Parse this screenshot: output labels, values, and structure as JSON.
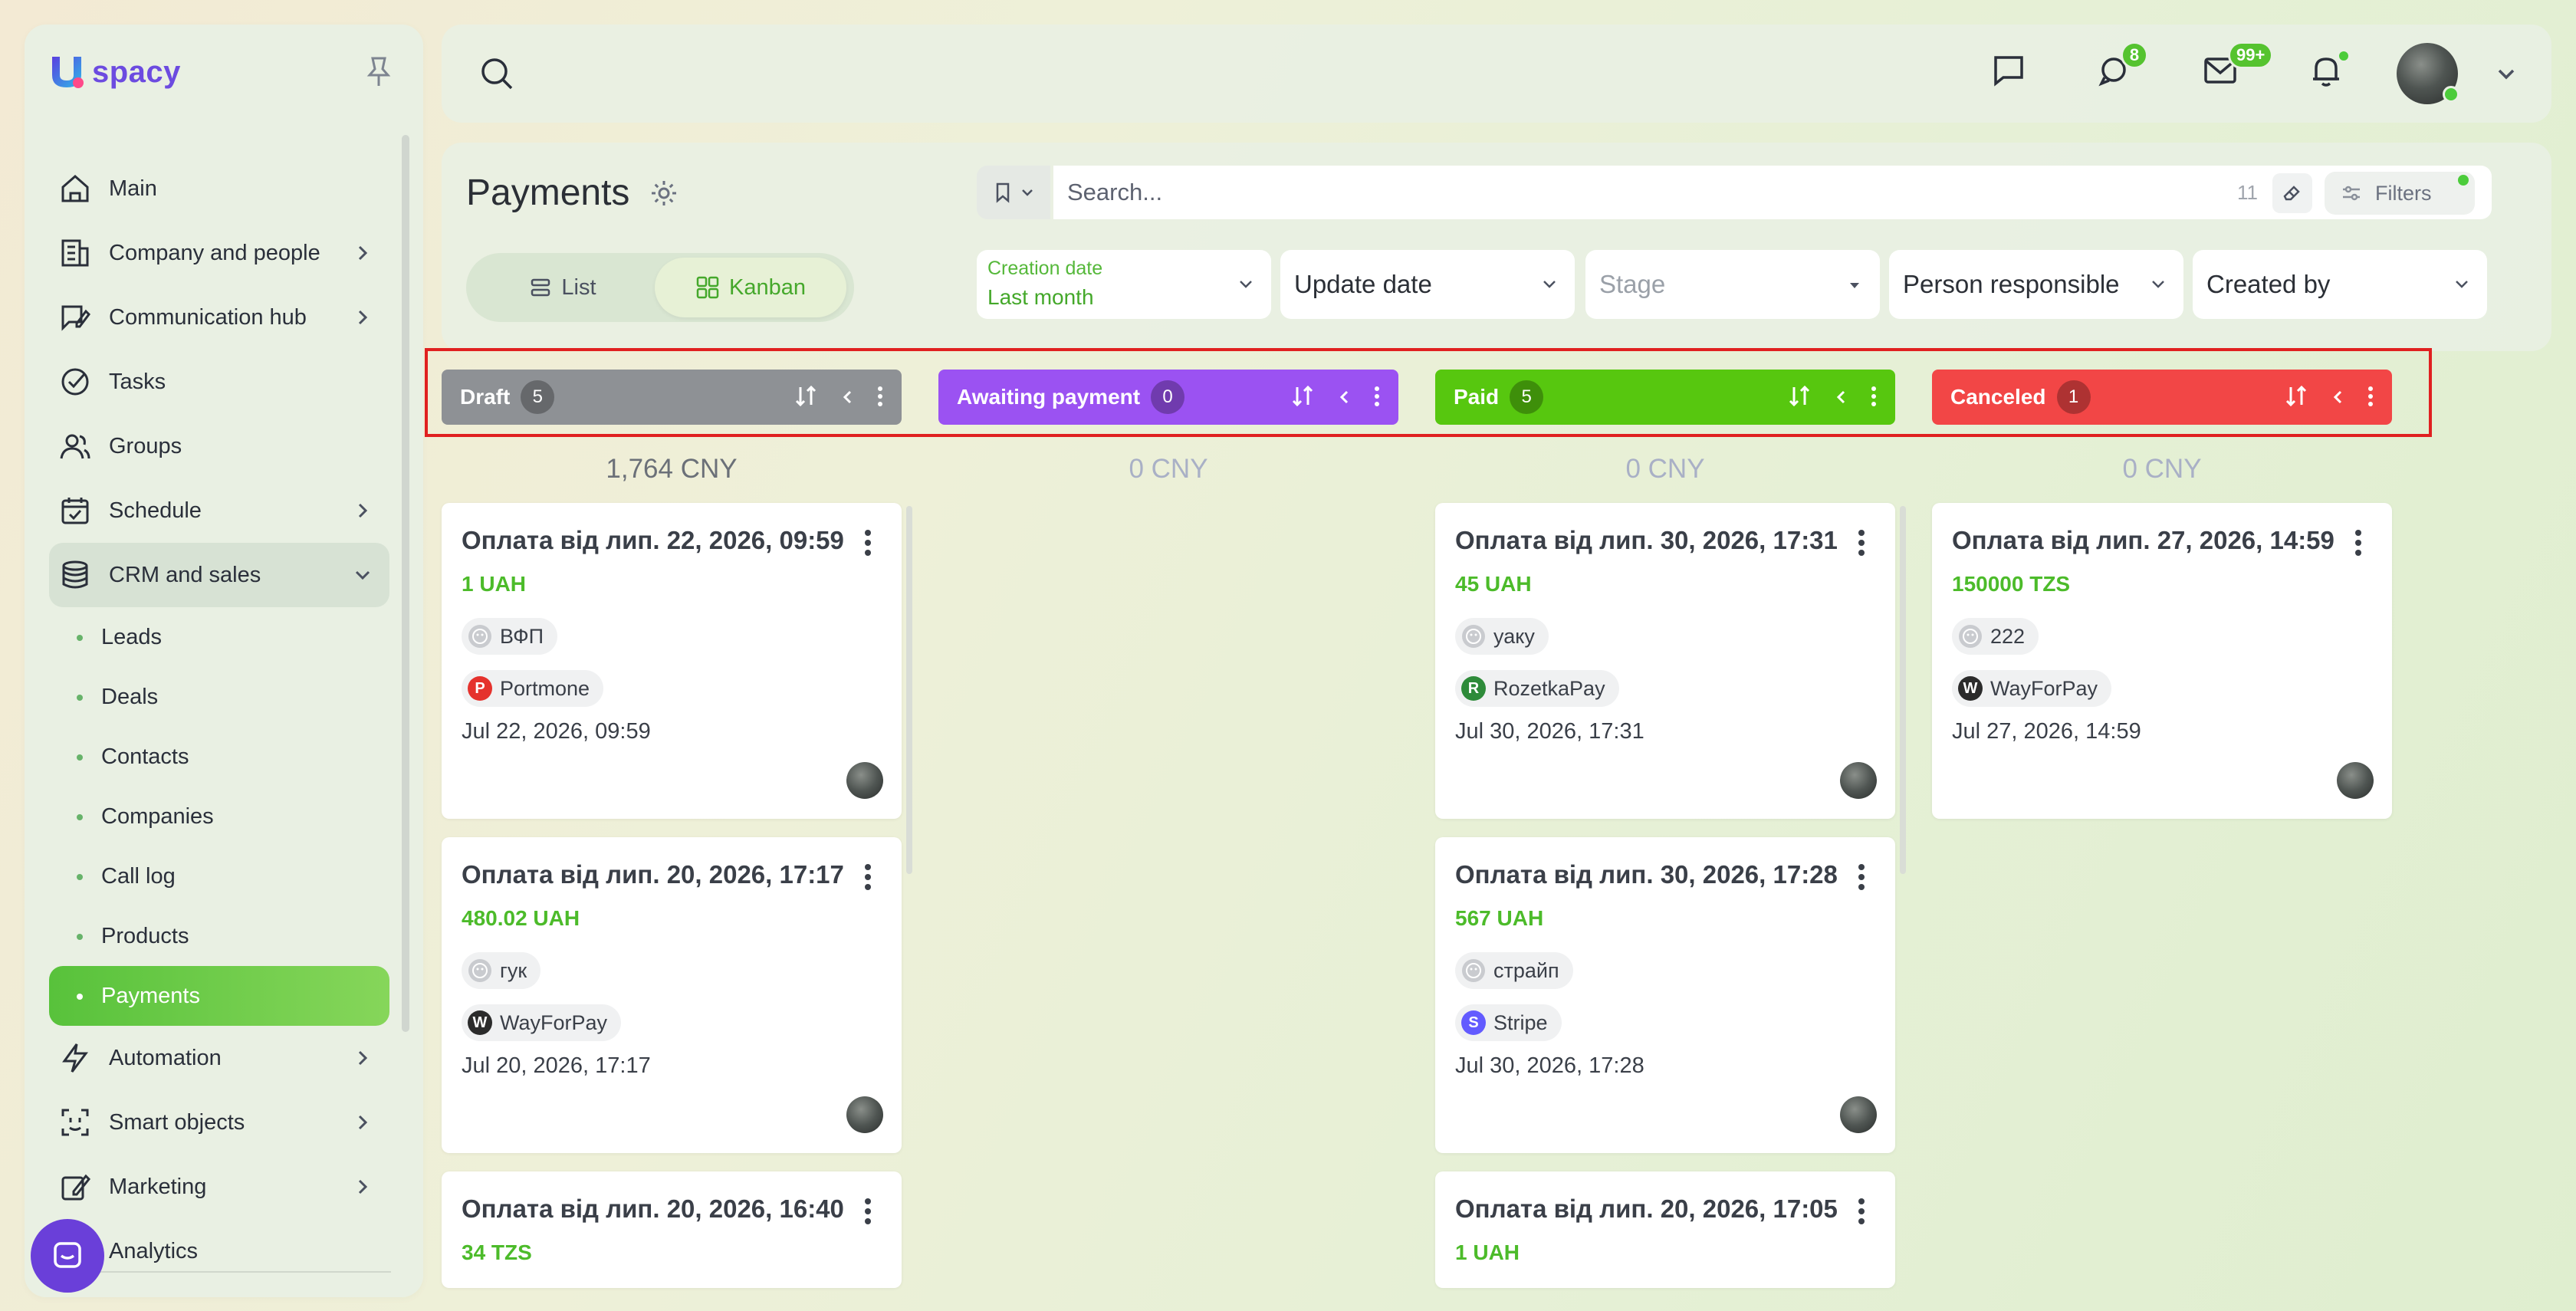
{
  "sidebar": {
    "logo_text": "spacy",
    "items": [
      {
        "label": "Main"
      },
      {
        "label": "Company and people"
      },
      {
        "label": "Communication hub"
      },
      {
        "label": "Tasks"
      },
      {
        "label": "Groups"
      },
      {
        "label": "Schedule"
      },
      {
        "label": "CRM and sales"
      },
      {
        "label": "Automation"
      },
      {
        "label": "Smart objects"
      },
      {
        "label": "Marketing"
      },
      {
        "label": "Analytics"
      }
    ],
    "crm_sub": [
      "Leads",
      "Deals",
      "Contacts",
      "Companies",
      "Call log",
      "Products",
      "Payments"
    ]
  },
  "topbar": {
    "chat_badge": "8",
    "mail_badge": "99+"
  },
  "header": {
    "title": "Payments",
    "view_list": "List",
    "view_kanban": "Kanban",
    "search_placeholder": "Search...",
    "search_count": "11",
    "filters_label": "Filters",
    "filter_creation_label": "Creation date",
    "filter_creation_value": "Last month",
    "filter_update": "Update date",
    "filter_stage": "Stage",
    "filter_person": "Person responsible",
    "filter_created_by": "Created by"
  },
  "columns": [
    {
      "name": "Draft",
      "count": "5",
      "total": "1,764 CNY",
      "color": "#8e9195",
      "total_color": "#6b7078",
      "cards": [
        {
          "title": "Оплата від лип. 22, 2026, 09:59",
          "amount": "1 UAH",
          "contact": "ВФП",
          "provider": "Portmone",
          "provider_color": "#e5322d",
          "provider_letter": "P",
          "date": "Jul 22, 2026, 09:59"
        },
        {
          "title": "Оплата від лип. 20, 2026, 17:17",
          "amount": "480.02 UAH",
          "contact": "гук",
          "provider": "WayForPay",
          "provider_color": "#2b2b2b",
          "provider_letter": "W",
          "date": "Jul 20, 2026, 17:17"
        },
        {
          "title": "Оплата від лип. 20, 2026, 16:40",
          "amount": "34 TZS",
          "contact": "",
          "provider": "",
          "provider_color": "",
          "provider_letter": "",
          "date": ""
        }
      ]
    },
    {
      "name": "Awaiting payment",
      "count": "0",
      "total": "0 CNY",
      "color": "#9b52f2",
      "total_color": "#a9b0c6",
      "cards": []
    },
    {
      "name": "Paid",
      "count": "5",
      "total": "0 CNY",
      "color": "#57c70f",
      "total_color": "#a9b0c6",
      "cards": [
        {
          "title": "Оплата від лип. 30, 2026, 17:31",
          "amount": "45 UAH",
          "contact": "уаку",
          "provider": "RozetkaPay",
          "provider_color": "#2e8b3a",
          "provider_letter": "R",
          "date": "Jul 30, 2026, 17:31"
        },
        {
          "title": "Оплата від лип. 30, 2026, 17:28",
          "amount": "567 UAH",
          "contact": "страйп",
          "provider": "Stripe",
          "provider_color": "#635bff",
          "provider_letter": "S",
          "date": "Jul 30, 2026, 17:28"
        },
        {
          "title": "Оплата від лип. 20, 2026, 17:05",
          "amount": "1 UAH",
          "contact": "",
          "provider": "",
          "provider_color": "",
          "provider_letter": "",
          "date": ""
        }
      ]
    },
    {
      "name": "Canceled",
      "count": "1",
      "total": "0 CNY",
      "color": "#f24646",
      "total_color": "#a9b0c6",
      "cards": [
        {
          "title": "Оплата від лип. 27, 2026, 14:59",
          "amount": "150000 TZS",
          "contact": "222",
          "provider": "WayForPay",
          "provider_color": "#2b2b2b",
          "provider_letter": "W",
          "date": "Jul 27, 2026, 14:59"
        }
      ]
    }
  ]
}
